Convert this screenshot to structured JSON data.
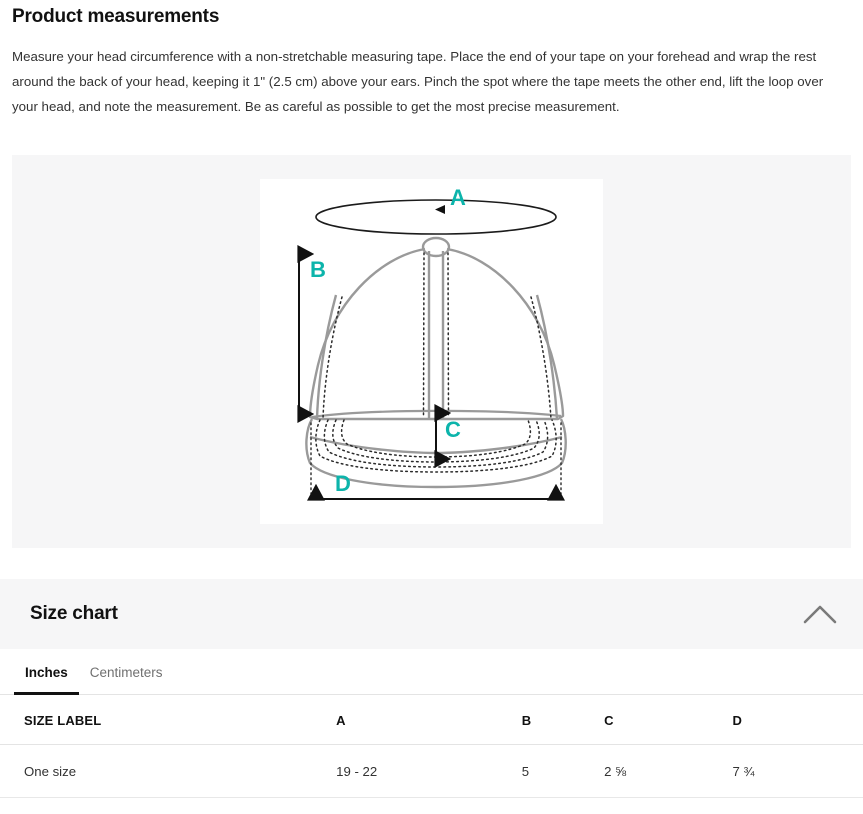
{
  "heading": {
    "title": "Product measurements",
    "description": "Measure your head circumference with a non-stretchable measuring tape. Place the end of your  tape on your forehead and wrap the rest around the back of your head, keeping it 1\" (2.5 cm) above your ears. Pinch the spot where the tape meets the other end, lift the loop over your head, and note the measurement. Be as careful as possible to get the most precise measurement."
  },
  "diagram": {
    "alt": "baseball-cap-measurement-diagram",
    "labels": {
      "a": "A",
      "b": "B",
      "c": "C",
      "d": "D"
    },
    "colors": {
      "label_teal": "#0CB4AB",
      "cap_outline": "#9a9a9a",
      "arrow_black": "#111111",
      "panel_bg": "#f6f6f7",
      "canvas_bg": "#ffffff"
    }
  },
  "size_chart": {
    "title": "Size chart",
    "collapse_icon": "chevron-up-icon",
    "expanded": true,
    "tabs": [
      {
        "label": "Inches",
        "active": true
      },
      {
        "label": "Centimeters",
        "active": false
      }
    ],
    "columns": [
      "SIZE LABEL",
      "A",
      "B",
      "C",
      "D"
    ],
    "rows": [
      {
        "size_label": "One size",
        "a": "19 - 22",
        "b": "5",
        "c": "2 ⅝",
        "d": "7 ¾"
      }
    ]
  }
}
